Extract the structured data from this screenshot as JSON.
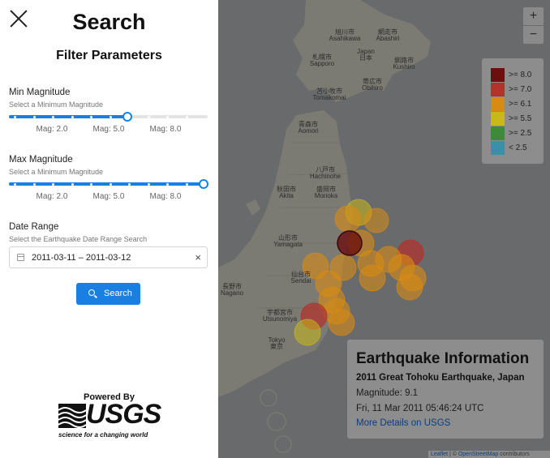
{
  "panel": {
    "title": "Search",
    "subtitle": "Filter Parameters",
    "min_magnitude": {
      "label": "Min Magnitude",
      "hint": "Select a Minimum Magnitude",
      "value": 5.0,
      "marks": [
        "Mag: 2.0",
        "Mag: 5.0",
        "Mag: 8.0"
      ]
    },
    "max_magnitude": {
      "label": "Max Magnitude",
      "hint": "Select a Minimum Magnitude",
      "value": 9.0,
      "marks": [
        "Mag: 2.0",
        "Mag: 5.0",
        "Mag: 8.0"
      ]
    },
    "date_range": {
      "label": "Date Range",
      "hint": "Select the Earthquake Date Range Search",
      "value": "2011-03-11 – 2011-03-12",
      "clear": "×"
    },
    "search_button": "Search",
    "powered_by": "Powered By",
    "usgs": {
      "word": "USGS",
      "tagline": "science for a changing world"
    }
  },
  "map": {
    "zoom_in": "+",
    "zoom_out": "−",
    "legend": [
      {
        "label": ">= 8.0",
        "color": "#6b0f0f"
      },
      {
        "label": ">= 7.0",
        "color": "#b5312b"
      },
      {
        "label": ">= 6.1",
        "color": "#d98a12"
      },
      {
        "label": ">= 5.5",
        "color": "#c9b81a"
      },
      {
        "label": ">= 2.5",
        "color": "#3f8a3a"
      },
      {
        "label": "< 2.5",
        "color": "#3c8fa8"
      }
    ],
    "cities": [
      {
        "jp": "旭川市",
        "en": "Asahikawa"
      },
      {
        "jp": "網走市",
        "en": "Abashiri"
      },
      {
        "jp": "日本",
        "en": "Japan"
      },
      {
        "jp": "札幌市",
        "en": "Sapporo"
      },
      {
        "jp": "釧路市",
        "en": "Kushiro"
      },
      {
        "jp": "帯広市",
        "en": "Obihiro"
      },
      {
        "jp": "苫小牧市",
        "en": "Tomakomai"
      },
      {
        "jp": "青森市",
        "en": "Aomori"
      },
      {
        "jp": "八戸市",
        "en": "Hachinohe"
      },
      {
        "jp": "秋田市",
        "en": "Akita"
      },
      {
        "jp": "盛岡市",
        "en": "Morioka"
      },
      {
        "jp": "山形市",
        "en": "Yamagata"
      },
      {
        "jp": "仙台市",
        "en": "Sendai"
      },
      {
        "jp": "長野市",
        "en": "Nagano"
      },
      {
        "jp": "宇都宮市",
        "en": "Utsunomiya"
      },
      {
        "jp": "東京",
        "en": "Tokyo"
      }
    ],
    "earthquake_info": {
      "heading": "Earthquake Information",
      "name": "2011 Great Tohoku Earthquake, Japan",
      "magnitude": "Magnitude: 9.1",
      "date": "Fri, 11 Mar 2011 05:46:24 UTC",
      "link": "More Details on USGS"
    },
    "attribution": {
      "leaflet": "Leaflet",
      "sep": " | © ",
      "osm": "OpenStreetMap",
      "rest": " contributors"
    }
  }
}
